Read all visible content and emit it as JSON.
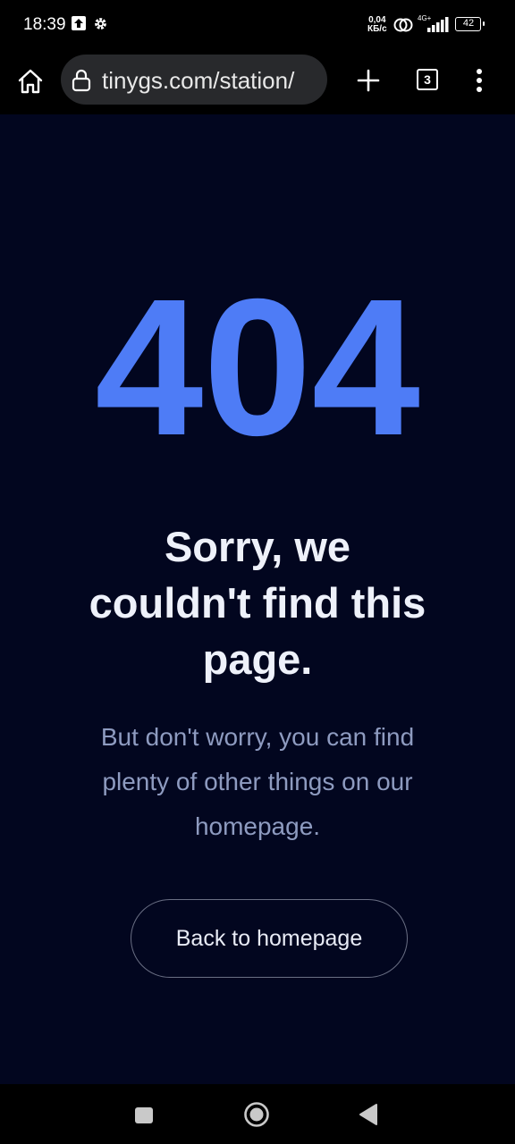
{
  "status_bar": {
    "time": "18:39",
    "net_speed_value": "0,04",
    "net_speed_unit": "КБ/с",
    "network_type": "4G+",
    "battery": "42"
  },
  "toolbar": {
    "url": "tinygs.com/station/",
    "tab_count": "3"
  },
  "page": {
    "error_code": "404",
    "headline": "Sorry, we couldn't find this page.",
    "subtext": "But don't worry, you can find plenty of other things on our homepage.",
    "button_label": "Back to homepage"
  },
  "colors": {
    "background": "#02061f",
    "accent": "#4e7cf6",
    "subtext": "#8e9bc0"
  }
}
